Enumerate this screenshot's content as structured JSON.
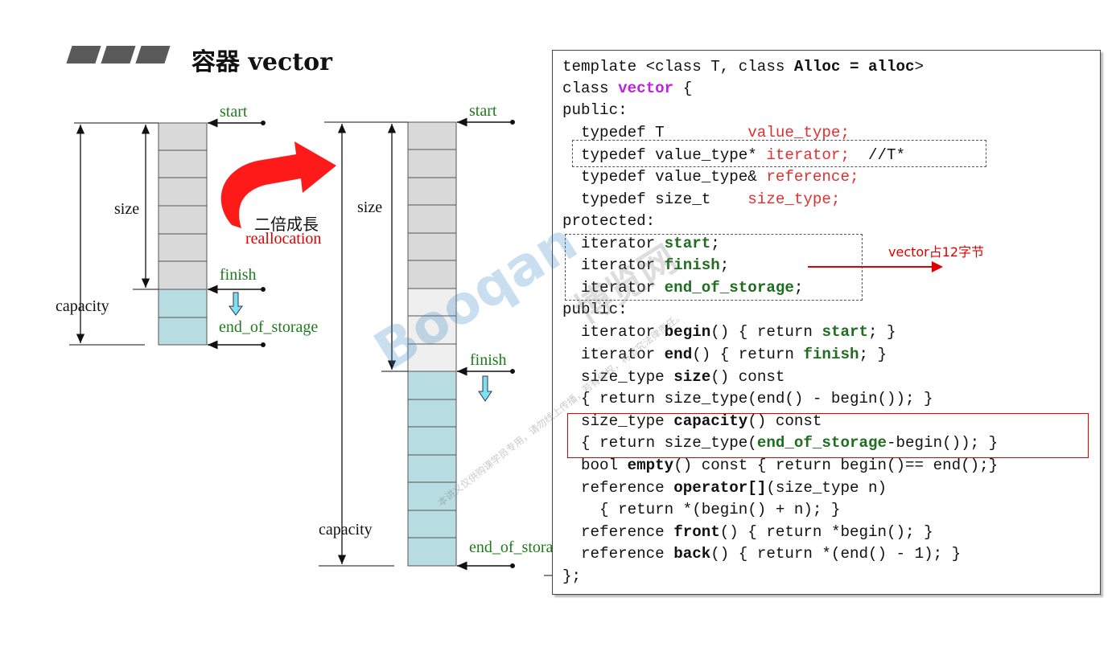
{
  "header": {
    "title": "容器 vector"
  },
  "left_diagram": {
    "start": "start",
    "size": "size",
    "finish": "finish",
    "capacity": "capacity",
    "end_of_storage": "end_of_storage"
  },
  "arrow_label": {
    "line1": "二倍成長",
    "line2": "reallocation"
  },
  "right_diagram": {
    "start": "start",
    "size": "size",
    "finish": "finish",
    "capacity": "capacity",
    "end_of_storage": "end_of_storage"
  },
  "code": {
    "l1a": "template <class T, class ",
    "l1b": "Alloc = alloc",
    "l1c": ">",
    "l2a": "class ",
    "l2b": "vector",
    "l2c": " {",
    "l3": "public:",
    "l4a": "  typedef T         ",
    "l4b": "value_type;",
    "l5a": "  typedef value_type* ",
    "l5b": "iterator;",
    "l5c": "  //T*",
    "l6a": "  typedef value_type& ",
    "l6b": "reference;",
    "l7a": "  typedef size_t    ",
    "l7b": "size_type;",
    "l8": "protected:",
    "l9a": "  iterator ",
    "l9b": "start",
    "l9c": ";",
    "l10a": "  iterator ",
    "l10b": "finish",
    "l10c": ";",
    "l11a": "  iterator ",
    "l11b": "end_of_storage",
    "l11c": ";",
    "l12": "public:",
    "l13a": "  iterator ",
    "l13b": "begin",
    "l13c": "() { return ",
    "l13d": "start",
    "l13e": "; }",
    "l14a": "  iterator ",
    "l14b": "end",
    "l14c": "() { return ",
    "l14d": "finish",
    "l14e": "; }",
    "l15a": "  size_type ",
    "l15b": "size",
    "l15c": "() const",
    "l16": "  { return size_type(end() - begin()); }",
    "l17a": "  size_type ",
    "l17b": "capacity",
    "l17c": "() const",
    "l18a": "  { return size_type(",
    "l18b": "end_of_storage",
    "l18c": "-begin()); }",
    "l19a": "  bool ",
    "l19b": "empty",
    "l19c": "() const { return begin()== end();}",
    "l20a": "  reference ",
    "l20b": "operator[]",
    "l20c": "(size_type n)",
    "l21": "    { return *(begin() + n); }",
    "l22a": "  reference ",
    "l22b": "front",
    "l22c": "() { return *begin(); }",
    "l23a": "  reference ",
    "l23b": "back",
    "l23c": "() { return *(end() - 1); }",
    "l24": "};"
  },
  "note": "vector占12字节",
  "watermark": {
    "brand": "Booqan",
    "cn": "博览网",
    "small": "本讲义仅供购课学员专用，请勿线上传播，若有侵权，将追究法律责任。"
  },
  "colors": {
    "red": "#e00000",
    "green": "#1f7a1f",
    "code_red": "#e03030",
    "keyword_magenta": "#c020e0",
    "cell_gray": "#d9d9d9",
    "cell_light": "#efefef",
    "cell_teal": "#b7dce2"
  }
}
